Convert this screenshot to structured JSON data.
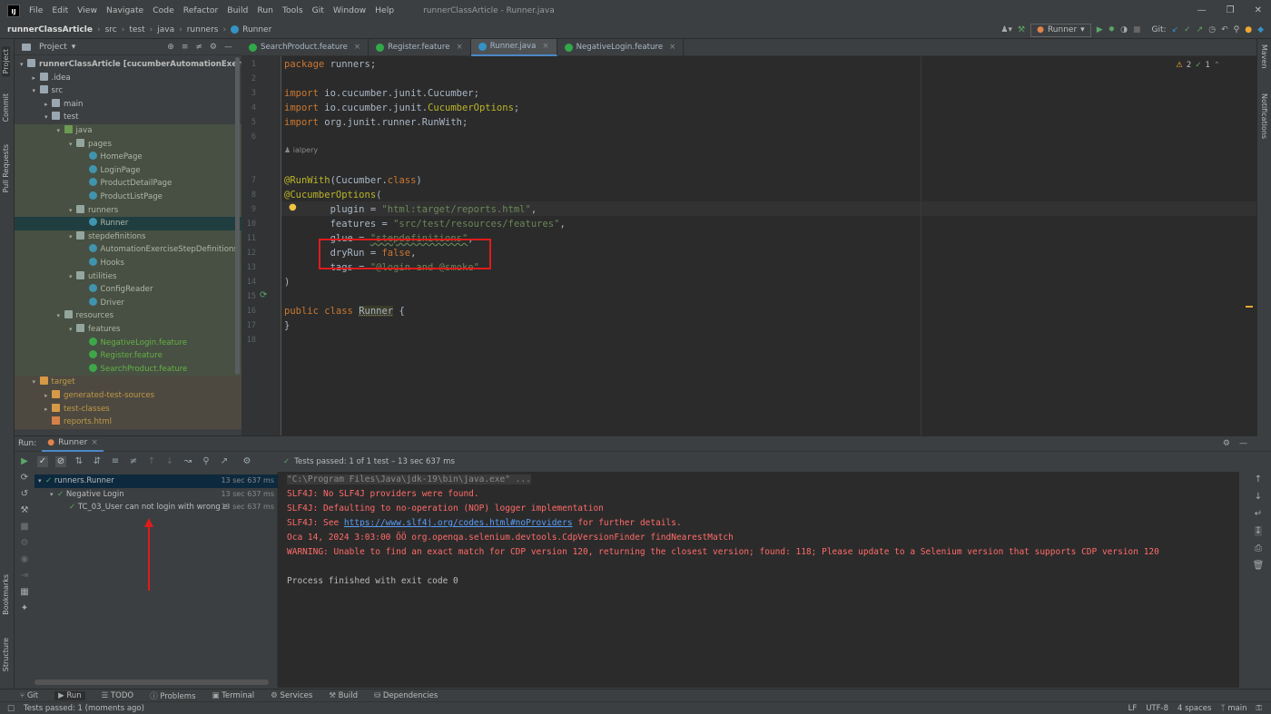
{
  "titlebar": {
    "logo": "IJ",
    "menu": [
      "File",
      "Edit",
      "View",
      "Navigate",
      "Code",
      "Refactor",
      "Build",
      "Run",
      "Tools",
      "Git",
      "Window",
      "Help"
    ],
    "title": "runnerClassArticle - Runner.java"
  },
  "navbar": {
    "breadcrumbs": [
      "runnerClassArticle",
      "src",
      "test",
      "java",
      "runners",
      "Runner"
    ],
    "run_config": "Runner",
    "git_label": "Git:"
  },
  "side_tools": {
    "left": [
      "Project",
      "Commit",
      "Pull Requests",
      "Bookmarks",
      "Structure"
    ],
    "right": [
      "Maven",
      "Notifications"
    ]
  },
  "project": {
    "header": "Project",
    "tree": [
      {
        "label": "runnerClassArticle",
        "suffix": "[cucumberAutomationExercises]",
        "path": " C:\\...",
        "depth": 0,
        "icon": "folder",
        "open": true
      },
      {
        "label": ".idea",
        "depth": 1,
        "icon": "folder",
        "open": false
      },
      {
        "label": "src",
        "depth": 1,
        "icon": "folder",
        "open": true
      },
      {
        "label": "main",
        "depth": 2,
        "icon": "folder",
        "open": false
      },
      {
        "label": "test",
        "depth": 2,
        "icon": "folder",
        "open": true
      },
      {
        "label": "java",
        "depth": 3,
        "icon": "folder-green",
        "open": true
      },
      {
        "label": "pages",
        "depth": 4,
        "icon": "folder",
        "open": true
      },
      {
        "label": "HomePage",
        "depth": 5,
        "icon": "class"
      },
      {
        "label": "LoginPage",
        "depth": 5,
        "icon": "class"
      },
      {
        "label": "ProductDetailPage",
        "depth": 5,
        "icon": "class"
      },
      {
        "label": "ProductListPage",
        "depth": 5,
        "icon": "class"
      },
      {
        "label": "runners",
        "depth": 4,
        "icon": "folder",
        "open": true
      },
      {
        "label": "Runner",
        "depth": 5,
        "icon": "class",
        "selected": true
      },
      {
        "label": "stepdefinitions",
        "depth": 4,
        "icon": "folder",
        "open": true
      },
      {
        "label": "AutomationExerciseStepDefinitions",
        "depth": 5,
        "icon": "class"
      },
      {
        "label": "Hooks",
        "depth": 5,
        "icon": "class"
      },
      {
        "label": "utilities",
        "depth": 4,
        "icon": "folder",
        "open": true
      },
      {
        "label": "ConfigReader",
        "depth": 5,
        "icon": "class"
      },
      {
        "label": "Driver",
        "depth": 5,
        "icon": "class"
      },
      {
        "label": "resources",
        "depth": 3,
        "icon": "folder",
        "open": true
      },
      {
        "label": "features",
        "depth": 4,
        "icon": "folder",
        "open": true
      },
      {
        "label": "NegativeLogin.feature",
        "depth": 5,
        "icon": "feature"
      },
      {
        "label": "Register.feature",
        "depth": 5,
        "icon": "feature"
      },
      {
        "label": "SearchProduct.feature",
        "depth": 5,
        "icon": "feature"
      },
      {
        "label": "target",
        "depth": 1,
        "icon": "folder-orange",
        "open": true,
        "excluded": true
      },
      {
        "label": "generated-test-sources",
        "depth": 2,
        "icon": "folder-orange",
        "open": false,
        "excluded": true
      },
      {
        "label": "test-classes",
        "depth": 2,
        "icon": "folder-orange",
        "open": false,
        "excluded": true
      },
      {
        "label": "reports.html",
        "depth": 2,
        "icon": "html",
        "excluded": true
      }
    ]
  },
  "tabs": [
    {
      "label": "SearchProduct.feature",
      "icon": "feature"
    },
    {
      "label": "Register.feature",
      "icon": "feature"
    },
    {
      "label": "Runner.java",
      "icon": "class",
      "active": true
    },
    {
      "label": "NegativeLogin.feature",
      "icon": "feature"
    }
  ],
  "editor": {
    "inspection_warn": "2",
    "inspection_ok": "1",
    "author": "ialpery",
    "lines": [
      {
        "n": "1",
        "parts": [
          [
            "kw",
            "package "
          ],
          [
            "pl",
            "runners;"
          ]
        ]
      },
      {
        "n": "2",
        "parts": []
      },
      {
        "n": "3",
        "parts": [
          [
            "kw",
            "import "
          ],
          [
            "pl",
            "io.cucumber.junit.Cucumber;"
          ]
        ]
      },
      {
        "n": "4",
        "parts": [
          [
            "kw",
            "import "
          ],
          [
            "pl",
            "io.cucumber.junit."
          ],
          [
            "ann",
            "CucumberOptions"
          ],
          [
            "pl",
            ";"
          ]
        ]
      },
      {
        "n": "5",
        "parts": [
          [
            "kw",
            "import "
          ],
          [
            "pl",
            "org.junit.runner.RunWith;"
          ]
        ]
      },
      {
        "n": "6",
        "parts": []
      },
      {
        "n": "7",
        "parts": [
          [
            "ann",
            "@RunWith"
          ],
          [
            "pl",
            "(Cucumber."
          ],
          [
            "kw",
            "class"
          ],
          [
            "pl",
            ")"
          ]
        ]
      },
      {
        "n": "8",
        "parts": [
          [
            "ann",
            "@CucumberOptions"
          ],
          [
            "pl",
            "("
          ]
        ]
      },
      {
        "n": "9",
        "parts": [
          [
            "pl",
            "        plugin = "
          ],
          [
            "str",
            "\"html:target/reports.html\""
          ],
          [
            "pl",
            ","
          ]
        ]
      },
      {
        "n": "10",
        "parts": [
          [
            "pl",
            "        features = "
          ],
          [
            "str",
            "\"src/test/resources/features\""
          ],
          [
            "pl",
            ","
          ]
        ]
      },
      {
        "n": "11",
        "parts": [
          [
            "pl",
            "        glue = "
          ],
          [
            "str",
            "\"stepdefinitions\""
          ],
          [
            "pl",
            ","
          ]
        ]
      },
      {
        "n": "12",
        "parts": [
          [
            "pl",
            "        dryRun = "
          ],
          [
            "kw",
            "false"
          ],
          [
            "pl",
            ","
          ]
        ]
      },
      {
        "n": "13",
        "parts": [
          [
            "pl",
            "        tags = "
          ],
          [
            "str",
            "\"@login and @smoke\""
          ]
        ]
      },
      {
        "n": "14",
        "parts": [
          [
            "pl",
            ")"
          ]
        ]
      },
      {
        "n": "15",
        "parts": []
      },
      {
        "n": "16",
        "parts": [
          [
            "kw",
            "public class "
          ],
          [
            "pl",
            "Runner"
          ],
          [
            "pl",
            " {"
          ]
        ]
      },
      {
        "n": "17",
        "parts": [
          [
            "pl",
            "}"
          ]
        ]
      },
      {
        "n": "18",
        "parts": []
      }
    ]
  },
  "run": {
    "label": "Run:",
    "tab": "Runner",
    "status": "Tests passed: 1 of 1 test – 13 sec 637 ms",
    "tree": [
      {
        "label": "runners.Runner",
        "time": "13 sec 637 ms",
        "depth": 0
      },
      {
        "label": "Negative Login",
        "time": "13 sec 637 ms",
        "depth": 1
      },
      {
        "label": "TC_03_User can not login with wrong ema",
        "time": "13 sec 637 ms",
        "depth": 2
      }
    ],
    "console": [
      {
        "text": "\"C:\\Program Files\\Java\\jdk-19\\bin\\java.exe\" ...",
        "color": "#8a8a8a",
        "bg": true
      },
      {
        "text": "SLF4J: No SLF4J providers were found.",
        "color": "#ff6b68"
      },
      {
        "text": "SLF4J: Defaulting to no-operation (NOP) logger implementation",
        "color": "#ff6b68"
      },
      {
        "text": "SLF4J: See ",
        "link": "https://www.slf4j.org/codes.html#noProviders",
        "after": " for further details.",
        "color": "#ff6b68"
      },
      {
        "text": "Oca 14, 2024 3:03:00 ÖÖ org.openqa.selenium.devtools.CdpVersionFinder findNearestMatch",
        "color": "#ff6b68"
      },
      {
        "text": "WARNING: Unable to find an exact match for CDP version 120, returning the closest version; found: 118; Please update to a Selenium version that supports CDP version 120",
        "color": "#ff6b68"
      },
      {
        "text": "",
        "color": "#bbbbbb"
      },
      {
        "text": "Process finished with exit code 0",
        "color": "#bbbbbb"
      }
    ]
  },
  "bottom_tools": [
    "Git",
    "Run",
    "TODO",
    "Problems",
    "Terminal",
    "Services",
    "Build",
    "Dependencies"
  ],
  "statusbar": {
    "left": "Tests passed: 1 (moments ago)",
    "lf": "LF",
    "encoding": "UTF-8",
    "indent": "4 spaces",
    "branch": "main"
  }
}
